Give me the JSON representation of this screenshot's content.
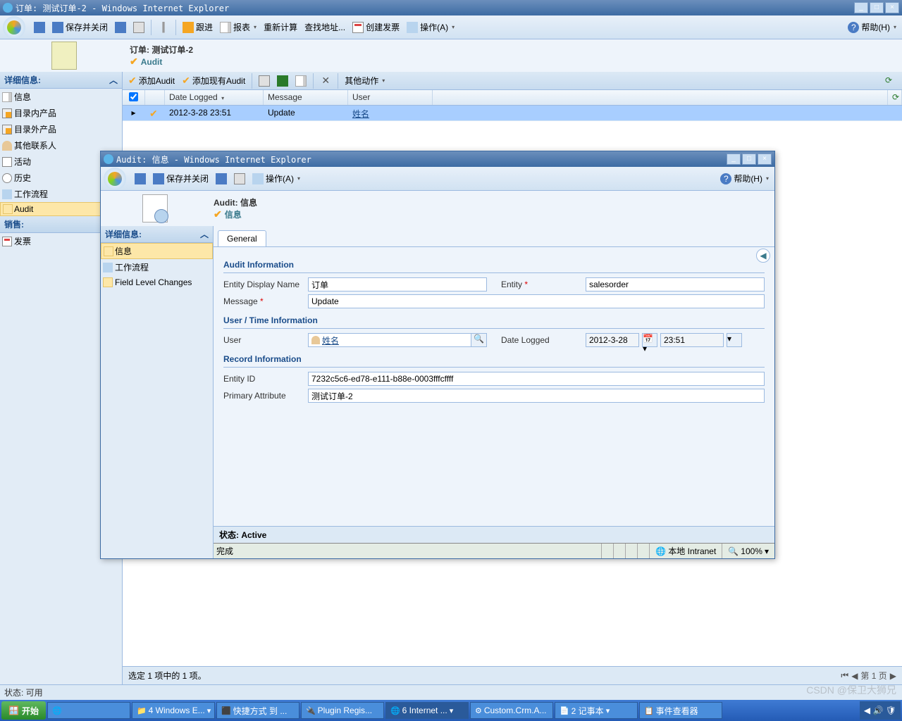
{
  "parent": {
    "title_prefix": "订单: 测试订单-2 - Windows Internet Explorer",
    "toolbar": {
      "save_close": "保存并关闭",
      "follow": "跟进",
      "report": "报表",
      "recalc": "重新计算",
      "lookup_addr": "查找地址...",
      "create_invoice": "创建发票",
      "actions": "操作(A)",
      "other_actions": "其他动作",
      "help": "帮助(H)"
    },
    "header": {
      "line1": "订单: 测试订单-2",
      "line2": "Audit"
    },
    "sidebar": {
      "section1": "详细信息:",
      "items": [
        "信息",
        "目录内产品",
        "目录外产品",
        "其他联系人",
        "活动",
        "历史",
        "工作流程",
        "Audit"
      ],
      "section2": "销售:",
      "items2": [
        "发票"
      ]
    },
    "subtoolbar": {
      "add_audit": "添加Audit",
      "add_existing": "添加现有Audit"
    },
    "grid": {
      "cols": [
        "Date Logged",
        "Message",
        "User"
      ],
      "rows": [
        {
          "date": "2012-3-28 23:51",
          "msg": "Update",
          "user": "姓名"
        }
      ]
    },
    "footer": {
      "selection": "选定 1 项中的 1 项。",
      "page": "第 1 页",
      "status": "状态: 可用",
      "intranet": "本地 Intranet",
      "zoom": "100%"
    }
  },
  "modal": {
    "title": "Audit: 信息 - Windows Internet Explorer",
    "toolbar": {
      "save_close": "保存并关闭",
      "actions": "操作(A)",
      "help": "帮助(H)"
    },
    "header": {
      "line1": "Audit: 信息",
      "line2": "信息"
    },
    "sidebar": {
      "hdr": "详细信息:",
      "items": [
        "信息",
        "工作流程",
        "Field Level Changes"
      ]
    },
    "tab": "General",
    "sections": {
      "audit_info": "Audit Information",
      "user_time": "User / Time Information",
      "record_info": "Record Information"
    },
    "fields": {
      "entity_display_name_lbl": "Entity Display Name",
      "entity_display_name": "订单",
      "entity_lbl": "Entity",
      "entity": "salesorder",
      "message_lbl": "Message",
      "message": "Update",
      "user_lbl": "User",
      "user": "姓名",
      "date_logged_lbl": "Date Logged",
      "date_logged": "2012-3-28",
      "time_logged": "23:51",
      "entity_id_lbl": "Entity ID",
      "entity_id": "7232c5c6-ed78-e111-b88e-0003fffcffff",
      "primary_attr_lbl": "Primary Attribute",
      "primary_attr": "测试订单-2"
    },
    "status": "状态: Active",
    "done": "完成",
    "intranet": "本地 Intranet",
    "zoom": "100%"
  },
  "taskbar": {
    "start": "开始",
    "items": [
      "4 Windows E...",
      "快捷方式 到 ...",
      "Plugin Regis...",
      "6 Internet ...",
      "Custom.Crm.A...",
      "2 记事本",
      "事件查看器"
    ],
    "watermark": "CSDN @保卫大狮兄"
  }
}
